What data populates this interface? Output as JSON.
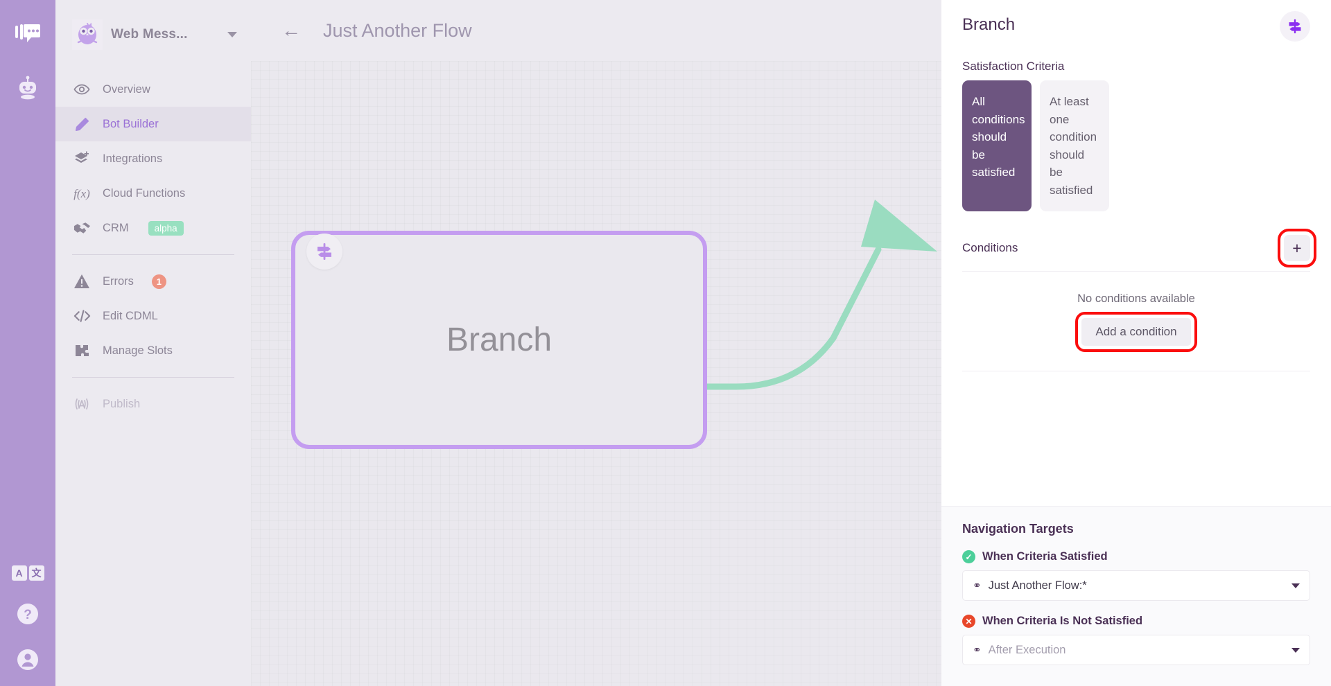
{
  "rail": {
    "icons": [
      {
        "name": "chat-logo-icon",
        "label": "Chat"
      },
      {
        "name": "bot-icon",
        "label": "Bot"
      }
    ],
    "bottom": [
      {
        "name": "language-toggle-icon",
        "a": "A",
        "b": "文"
      },
      {
        "name": "help-icon",
        "label": "?"
      },
      {
        "name": "account-icon",
        "label": "Account"
      }
    ]
  },
  "sidebar": {
    "workspace": {
      "name": "Web Mess...",
      "logo": "owl-logo"
    },
    "items": [
      {
        "label": "Overview",
        "icon": "eye-icon",
        "state": "normal"
      },
      {
        "label": "Bot Builder",
        "icon": "pencil-icon",
        "state": "active"
      },
      {
        "label": "Integrations",
        "icon": "layers-plus-icon",
        "state": "normal"
      },
      {
        "label": "Cloud Functions",
        "icon": "function-icon",
        "state": "normal"
      },
      {
        "label": "CRM",
        "icon": "handshake-icon",
        "state": "normal",
        "badge": "alpha"
      },
      {
        "label": "Errors",
        "icon": "warning-icon",
        "state": "normal",
        "count": "1"
      },
      {
        "label": "Edit CDML",
        "icon": "code-icon",
        "state": "normal"
      },
      {
        "label": "Manage Slots",
        "icon": "puzzle-icon",
        "state": "normal"
      },
      {
        "label": "Publish",
        "icon": "broadcast-icon",
        "state": "disabled"
      }
    ]
  },
  "topbar": {
    "back": "←",
    "flow_title": "Just Another Flow"
  },
  "canvas": {
    "branch_node": {
      "label": "Branch",
      "icon": "signpost-icon",
      "border_color": "#c49df0"
    },
    "green_node": {
      "icon_a": "check-circle-icon",
      "icon_b": "message-icon",
      "border_color": "#9adcc0"
    },
    "connector_color": "#9adcc0"
  },
  "panel": {
    "title": "Branch",
    "head_icon": "signpost-icon",
    "satisfaction": {
      "label": "Satisfaction Criteria",
      "options": [
        {
          "text": "All conditions should be satisfied",
          "selected": true
        },
        {
          "text": "At least one condition should be satisfied",
          "selected": false
        }
      ]
    },
    "conditions": {
      "title": "Conditions",
      "add_icon": "plus-icon",
      "empty_text": "No conditions available",
      "add_button": "Add a condition"
    },
    "navigation": {
      "title": "Navigation Targets",
      "satisfied": {
        "label": "When Criteria Satisfied",
        "icon": "check-circle-icon",
        "value": "Just Another Flow:*",
        "is_placeholder": false
      },
      "not_satisfied": {
        "label": "When Criteria Is Not Satisfied",
        "icon": "x-circle-icon",
        "value": "After Execution",
        "is_placeholder": true
      }
    }
  },
  "highlight_color": "#fb0d0d"
}
